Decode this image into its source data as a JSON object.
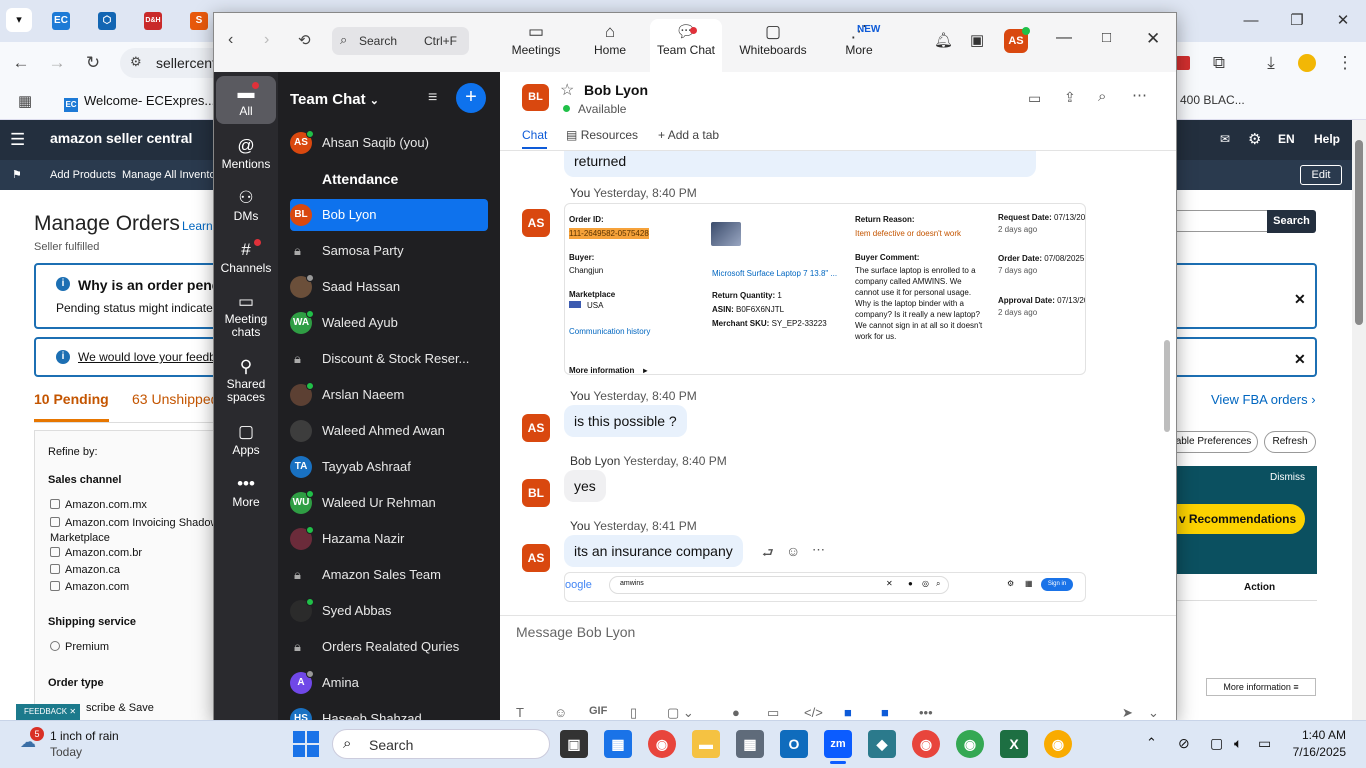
{
  "chrome": {
    "tab_icons": [
      "EC",
      "⬡",
      "D&H",
      "S"
    ],
    "url": "sellercent",
    "bookmarks": [
      {
        "label": "Welcome- ECExpres..."
      }
    ],
    "bookmark_right": "400 BLAC...",
    "window_buttons": [
      "—",
      "❐",
      "✕"
    ]
  },
  "amazon": {
    "logo": "amazon seller central",
    "search_btn": "Search",
    "lang": "EN",
    "help": "Help",
    "sub_nav": [
      "Add Products",
      "Manage All Inventor"
    ],
    "edit": "Edit",
    "title": "Manage Orders",
    "learn": "Learn",
    "fulfilled": "Seller fulfilled",
    "info1_title": "Why is an order pendi",
    "info1_text": "Pending status might indicate an",
    "info2_text": "We would love your feedback",
    "tab_pending": "10 Pending",
    "tab_unshipped": "63 Unshipped",
    "view_fba": "View FBA orders",
    "refine": "Refine by:",
    "sales_channel": "Sales channel",
    "channels": [
      "Amazon.com.mx",
      "Amazon.com Invoicing Shadow Marketplace",
      "Amazon.com.br",
      "Amazon.ca",
      "Amazon.com"
    ],
    "shipping_service": "Shipping service",
    "premium": "Premium",
    "order_type": "Order type",
    "subscribe": "scribe & Save",
    "table_prefs": "able Preferences",
    "refresh": "Refresh",
    "dismiss": "Dismiss",
    "recommendations": "v Recommendations",
    "action": "Action",
    "more_info": "More information",
    "feedback": "FEEDBACK"
  },
  "zoom": {
    "search_placeholder": "Search",
    "search_shortcut": "Ctrl+F",
    "tabs": [
      {
        "label": "Meetings",
        "icon": "video-icon"
      },
      {
        "label": "Home",
        "icon": "home-icon"
      },
      {
        "label": "Team Chat",
        "icon": "chat-icon"
      },
      {
        "label": "Whiteboards",
        "icon": "whiteboard-icon"
      },
      {
        "label": "More",
        "icon": "more-icon"
      }
    ],
    "new_badge": "NEW",
    "user_initials": "AS",
    "rail": [
      {
        "label": "All",
        "icon": "chat-bubble-icon"
      },
      {
        "label": "Mentions",
        "icon": "at-icon"
      },
      {
        "label": "DMs",
        "icon": "people-icon"
      },
      {
        "label": "Channels",
        "icon": "hash-icon"
      },
      {
        "label": "Meeting chats",
        "icon": "meeting-chat-icon"
      },
      {
        "label": "Shared spaces",
        "icon": "shared-icon"
      },
      {
        "label": "Apps",
        "icon": "apps-icon"
      },
      {
        "label": "More",
        "icon": "ellipsis-icon"
      }
    ],
    "list_title": "Team Chat",
    "list": [
      {
        "label": "Ahsan Saqib (you)",
        "initials": "AS",
        "color": "#d9480f",
        "type": "person",
        "status": "online"
      },
      {
        "label": "Attendance",
        "type": "bold"
      },
      {
        "label": "Bob Lyon",
        "initials": "BL",
        "color": "#d9480f",
        "type": "person",
        "selected": true
      },
      {
        "label": "Samosa Party",
        "type": "channel"
      },
      {
        "label": "Saad Hassan",
        "initials": "",
        "color": "#6b4f3a",
        "type": "person",
        "status": "away"
      },
      {
        "label": "Waleed Ayub",
        "initials": "WA",
        "color": "#2f9e44",
        "type": "person",
        "status": "online"
      },
      {
        "label": "Discount & Stock Reser...",
        "type": "channel"
      },
      {
        "label": "Arslan Naeem",
        "initials": "",
        "color": "#5c4033",
        "type": "person",
        "status": "mobile"
      },
      {
        "label": "Waleed Ahmed Awan",
        "initials": "",
        "color": "#3d3d3d",
        "type": "person"
      },
      {
        "label": "Tayyab Ashraaf",
        "initials": "TA",
        "color": "#1971c2",
        "type": "person"
      },
      {
        "label": "Waleed Ur Rehman",
        "initials": "WU",
        "color": "#2f9e44",
        "type": "person",
        "status": "online"
      },
      {
        "label": "Hazama Nazir",
        "initials": "",
        "color": "#6b2b3a",
        "type": "person",
        "status": "online"
      },
      {
        "label": "Amazon Sales Team",
        "type": "channel"
      },
      {
        "label": "Syed Abbas",
        "initials": "",
        "color": "#2b2b2b",
        "type": "person",
        "status": "online"
      },
      {
        "label": "Orders Realated Quries",
        "type": "channel"
      },
      {
        "label": "Amina",
        "initials": "A",
        "color": "#7048e8",
        "type": "person",
        "status": "away"
      },
      {
        "label": "Haseeb Shahzad",
        "initials": "HS",
        "color": "#1971c2",
        "type": "person"
      }
    ],
    "chat": {
      "name": "Bob Lyon",
      "initials": "BL",
      "status": "Available",
      "tabs": [
        "Chat",
        "Resources",
        "Add a tab"
      ],
      "prev_message": "returned",
      "messages": [
        {
          "sender": "You",
          "time": "Yesterday, 8:40 PM",
          "initials": "AS",
          "kind": "image"
        },
        {
          "sender": "You",
          "time": "Yesterday, 8:40 PM",
          "initials": "AS",
          "text": "is this possible ?"
        },
        {
          "sender": "Bob Lyon",
          "time": "Yesterday, 8:40 PM",
          "initials": "BL",
          "text": "yes"
        },
        {
          "sender": "You",
          "time": "Yesterday, 8:41 PM",
          "initials": "AS",
          "text": "its an insurance company"
        }
      ],
      "order_card": {
        "order_id_label": "Order ID:",
        "order_id": "111-2649582-0575428",
        "buyer_label": "Buyer:",
        "buyer": "Changjun",
        "marketplace_label": "Marketplace",
        "marketplace": "USA",
        "comm_history": "Communication history",
        "more_info": "More information",
        "product": "Microsoft Surface Laptop 7 13.8\" ...",
        "return_qty_label": "Return Quantity:",
        "return_qty": "1",
        "asin_label": "ASIN:",
        "asin": "B0F6X6NJTL",
        "sku_label": "Merchant SKU:",
        "sku": "SY_EP2-33223",
        "return_reason_label": "Return Reason:",
        "return_reason": "Item defective or doesn't work",
        "buyer_comment_label": "Buyer Comment:",
        "buyer_comment": "The surface laptop is enrolled to a company called AMWINS. We cannot use it for personal usage. Why is the laptop binder with a company? Is it really a new laptop? We cannot sign in at all so it doesn't work for us.",
        "request_date_label": "Request Date:",
        "request_date": "07/13/20",
        "request_ago": "2 days ago",
        "order_date_label": "Order Date:",
        "order_date": "07/08/2025",
        "order_ago": "7 days ago",
        "approval_date_label": "Approval Date:",
        "approval_date": "07/13/20",
        "approval_ago": "2 days ago"
      },
      "google_logo": "oogle",
      "google_query": "amwins",
      "google_signin": "Sign in",
      "composer_placeholder": "Message Bob Lyon",
      "composer_gif": "GIF"
    }
  },
  "taskbar": {
    "weather_badge": "5",
    "weather": "1 inch of rain",
    "weather_sub": "Today",
    "search": "Search",
    "time": "1:40 AM",
    "date": "7/16/2025"
  }
}
